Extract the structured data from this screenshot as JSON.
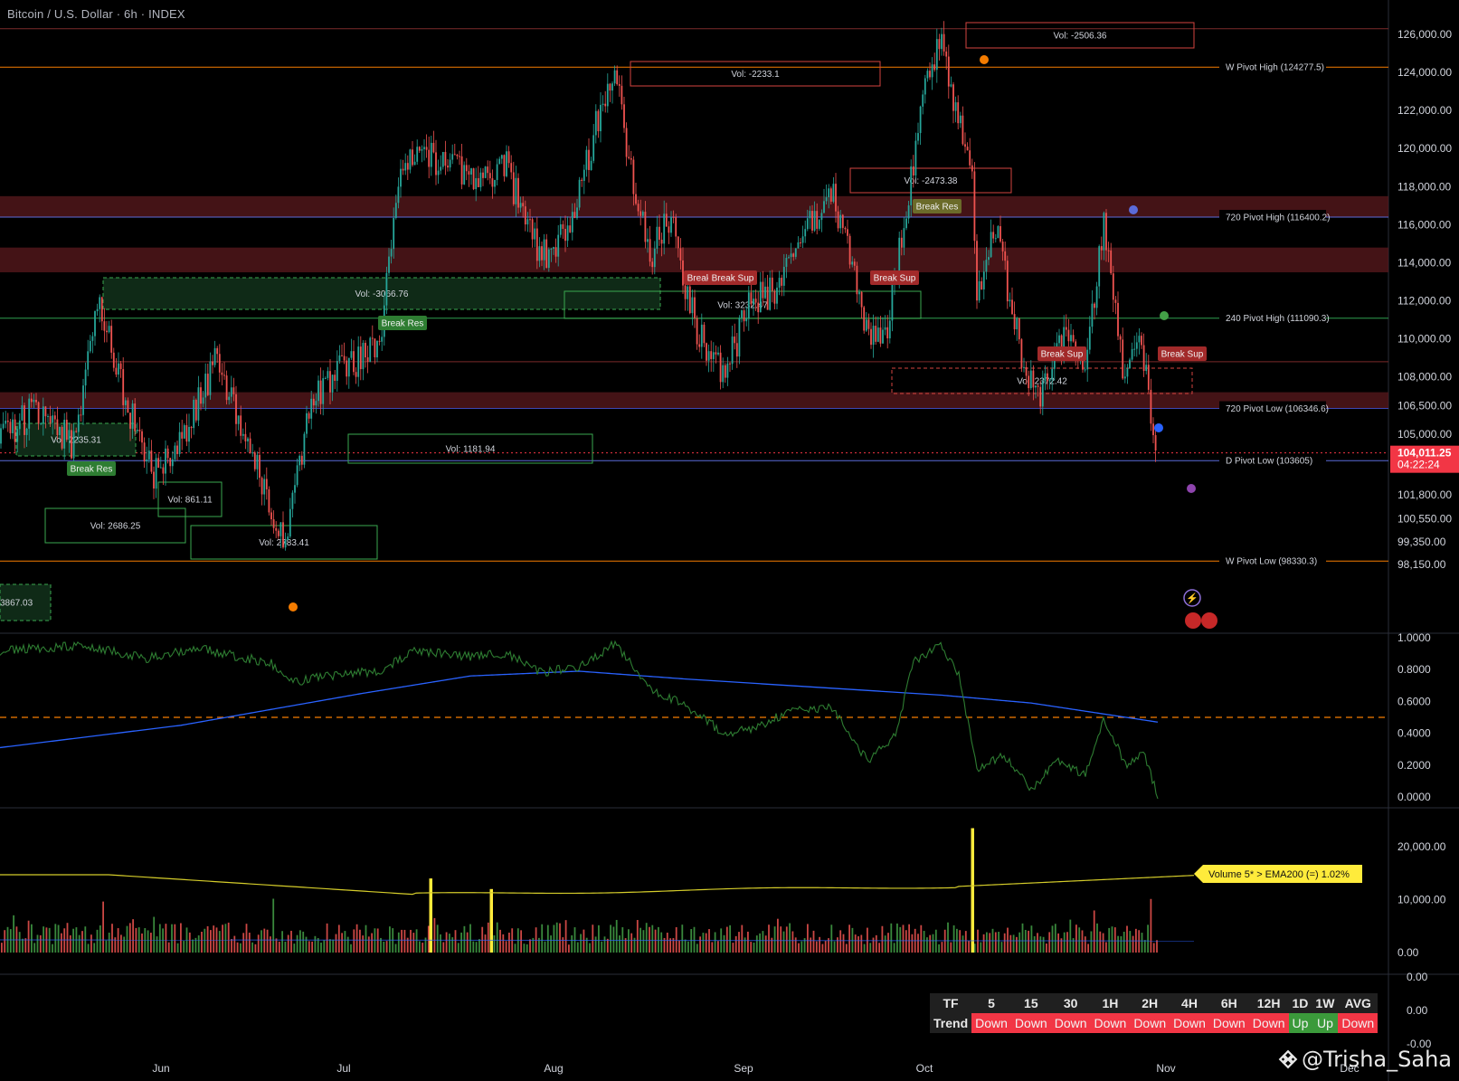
{
  "header": {
    "title": "Bitcoin / U.S. Dollar · 6h · INDEX"
  },
  "colors": {
    "bg": "#000000",
    "up": "#26a69a",
    "up_alt": "#2e7d32",
    "down": "#ef5350",
    "zone_red": "#5b1a1e",
    "zone_green": "#0f2a17",
    "ema": "#2962ff",
    "volume_ema": "#d4cc2a",
    "orange": "#f57c00",
    "price_badge": "#f23645",
    "trend_up": "#3b9a3b"
  },
  "price_axis": {
    "ticks": [
      "126,000.00",
      "124,000.00",
      "122,000.00",
      "120,000.00",
      "118,000.00",
      "116,000.00",
      "114,000.00",
      "112,000.00",
      "110,000.00",
      "108,000.00",
      "106,500.00",
      "105,000.00",
      "101,800.00",
      "100,550.00",
      "99,350.00",
      "98,150.00"
    ],
    "current_price": "104,011.25",
    "countdown": "04:22:24"
  },
  "time_axis": {
    "labels": [
      "Jun",
      "Jul",
      "Aug",
      "Sep",
      "Oct",
      "Nov",
      "Dec"
    ]
  },
  "pivot_labels": [
    "W Pivot High (124277.5)",
    "720 Pivot High (116400.2)",
    "240 Pivot High (111090.3)",
    "720 Pivot Low (106346.6)",
    "D Pivot Low (103605)",
    "W Pivot Low (98330.3)"
  ],
  "volume_boxes": [
    "Vol: -2506.36",
    "Vol: -2233.1",
    "Vol: -2473.38",
    "Vol: -3066.76",
    "Vol: 3232.47",
    "Vol: 2372.42",
    "Vol: 2235.31",
    "Vol: 1181.94",
    "Vol: 861.11",
    "Vol: 2686.25",
    "Vol: 2783.41",
    "3867.03"
  ],
  "break_tags": [
    "Break Res",
    "Break Res",
    "Break Res",
    "Break Sup",
    "Break Sup",
    "Break Sup",
    "Break Sup",
    "Break Sup"
  ],
  "oscillator_axis": [
    "1.0000",
    "0.8000",
    "0.6000",
    "0.4000",
    "0.2000",
    "0.0000"
  ],
  "volume_axis": [
    "20,000.00",
    "10,000.00",
    "0.00"
  ],
  "volume_tag": "Volume 5* > EMA200 (=) 1.02%",
  "bottom_axis": [
    "0.00",
    "0.00",
    "-0.00"
  ],
  "trend_table": {
    "header": [
      "TF",
      "5",
      "15",
      "30",
      "1H",
      "2H",
      "4H",
      "6H",
      "12H",
      "1D",
      "1W",
      "AVG"
    ],
    "row_label": "Trend",
    "values": [
      "Down",
      "Down",
      "Down",
      "Down",
      "Down",
      "Down",
      "Down",
      "Down",
      "Up",
      "Up",
      "Down"
    ]
  },
  "watermark": "@Trisha_Saha",
  "chart_data": {
    "type": "candlestick",
    "title": "Bitcoin / U.S. Dollar · 6h · INDEX",
    "x_labels": [
      "Jun",
      "Jul",
      "Aug",
      "Sep",
      "Oct",
      "Nov",
      "Dec"
    ],
    "ylim": [
      97000,
      127000
    ],
    "anchors": [
      [
        0,
        104500
      ],
      [
        40,
        106500
      ],
      [
        80,
        104500
      ],
      [
        110,
        112000
      ],
      [
        140,
        106500
      ],
      [
        170,
        103000
      ],
      [
        200,
        104500
      ],
      [
        240,
        109000
      ],
      [
        280,
        104000
      ],
      [
        315,
        99000
      ],
      [
        345,
        107000
      ],
      [
        380,
        108500
      ],
      [
        420,
        109500
      ],
      [
        440,
        118000
      ],
      [
        460,
        120000
      ],
      [
        500,
        119000
      ],
      [
        530,
        118000
      ],
      [
        560,
        119000
      ],
      [
        590,
        115000
      ],
      [
        610,
        114000
      ],
      [
        640,
        117500
      ],
      [
        660,
        121500
      ],
      [
        680,
        124000
      ],
      [
        700,
        118000
      ],
      [
        720,
        114500
      ],
      [
        740,
        116500
      ],
      [
        770,
        110500
      ],
      [
        800,
        108000
      ],
      [
        830,
        112000
      ],
      [
        860,
        112500
      ],
      [
        890,
        116000
      ],
      [
        920,
        117500
      ],
      [
        945,
        113500
      ],
      [
        960,
        110000
      ],
      [
        980,
        110500
      ],
      [
        1000,
        116500
      ],
      [
        1020,
        122500
      ],
      [
        1040,
        125500
      ],
      [
        1060,
        121500
      ],
      [
        1075,
        118000
      ],
      [
        1080,
        112500
      ],
      [
        1100,
        116000
      ],
      [
        1130,
        109000
      ],
      [
        1150,
        107000
      ],
      [
        1180,
        110500
      ],
      [
        1200,
        108500
      ],
      [
        1220,
        116000
      ],
      [
        1245,
        107500
      ],
      [
        1260,
        110000
      ],
      [
        1270,
        107000
      ],
      [
        1280,
        104000
      ]
    ],
    "oscillator": {
      "green_anchors": [
        [
          0,
          0.92
        ],
        [
          100,
          0.95
        ],
        [
          160,
          0.87
        ],
        [
          220,
          0.93
        ],
        [
          300,
          0.84
        ],
        [
          320,
          0.72
        ],
        [
          360,
          0.76
        ],
        [
          420,
          0.79
        ],
        [
          460,
          0.92
        ],
        [
          520,
          0.88
        ],
        [
          560,
          0.9
        ],
        [
          600,
          0.78
        ],
        [
          640,
          0.82
        ],
        [
          680,
          0.96
        ],
        [
          720,
          0.68
        ],
        [
          760,
          0.57
        ],
        [
          800,
          0.4
        ],
        [
          830,
          0.43
        ],
        [
          880,
          0.55
        ],
        [
          920,
          0.56
        ],
        [
          960,
          0.22
        ],
        [
          990,
          0.4
        ],
        [
          1010,
          0.85
        ],
        [
          1040,
          0.95
        ],
        [
          1060,
          0.78
        ],
        [
          1080,
          0.18
        ],
        [
          1110,
          0.26
        ],
        [
          1140,
          0.05
        ],
        [
          1170,
          0.23
        ],
        [
          1200,
          0.14
        ],
        [
          1220,
          0.49
        ],
        [
          1245,
          0.2
        ],
        [
          1265,
          0.27
        ],
        [
          1280,
          0.01
        ]
      ],
      "blue_anchors": [
        [
          0,
          0.31
        ],
        [
          200,
          0.45
        ],
        [
          400,
          0.65
        ],
        [
          520,
          0.76
        ],
        [
          640,
          0.79
        ],
        [
          760,
          0.74
        ],
        [
          900,
          0.69
        ],
        [
          1040,
          0.64
        ],
        [
          1140,
          0.59
        ],
        [
          1280,
          0.47
        ]
      ],
      "level": 0.5
    },
    "volume": {
      "ylim": [
        0,
        25000
      ],
      "spikes": [
        [
          476,
          14000
        ],
        [
          543,
          12000
        ],
        [
          1075,
          23500
        ]
      ]
    }
  }
}
